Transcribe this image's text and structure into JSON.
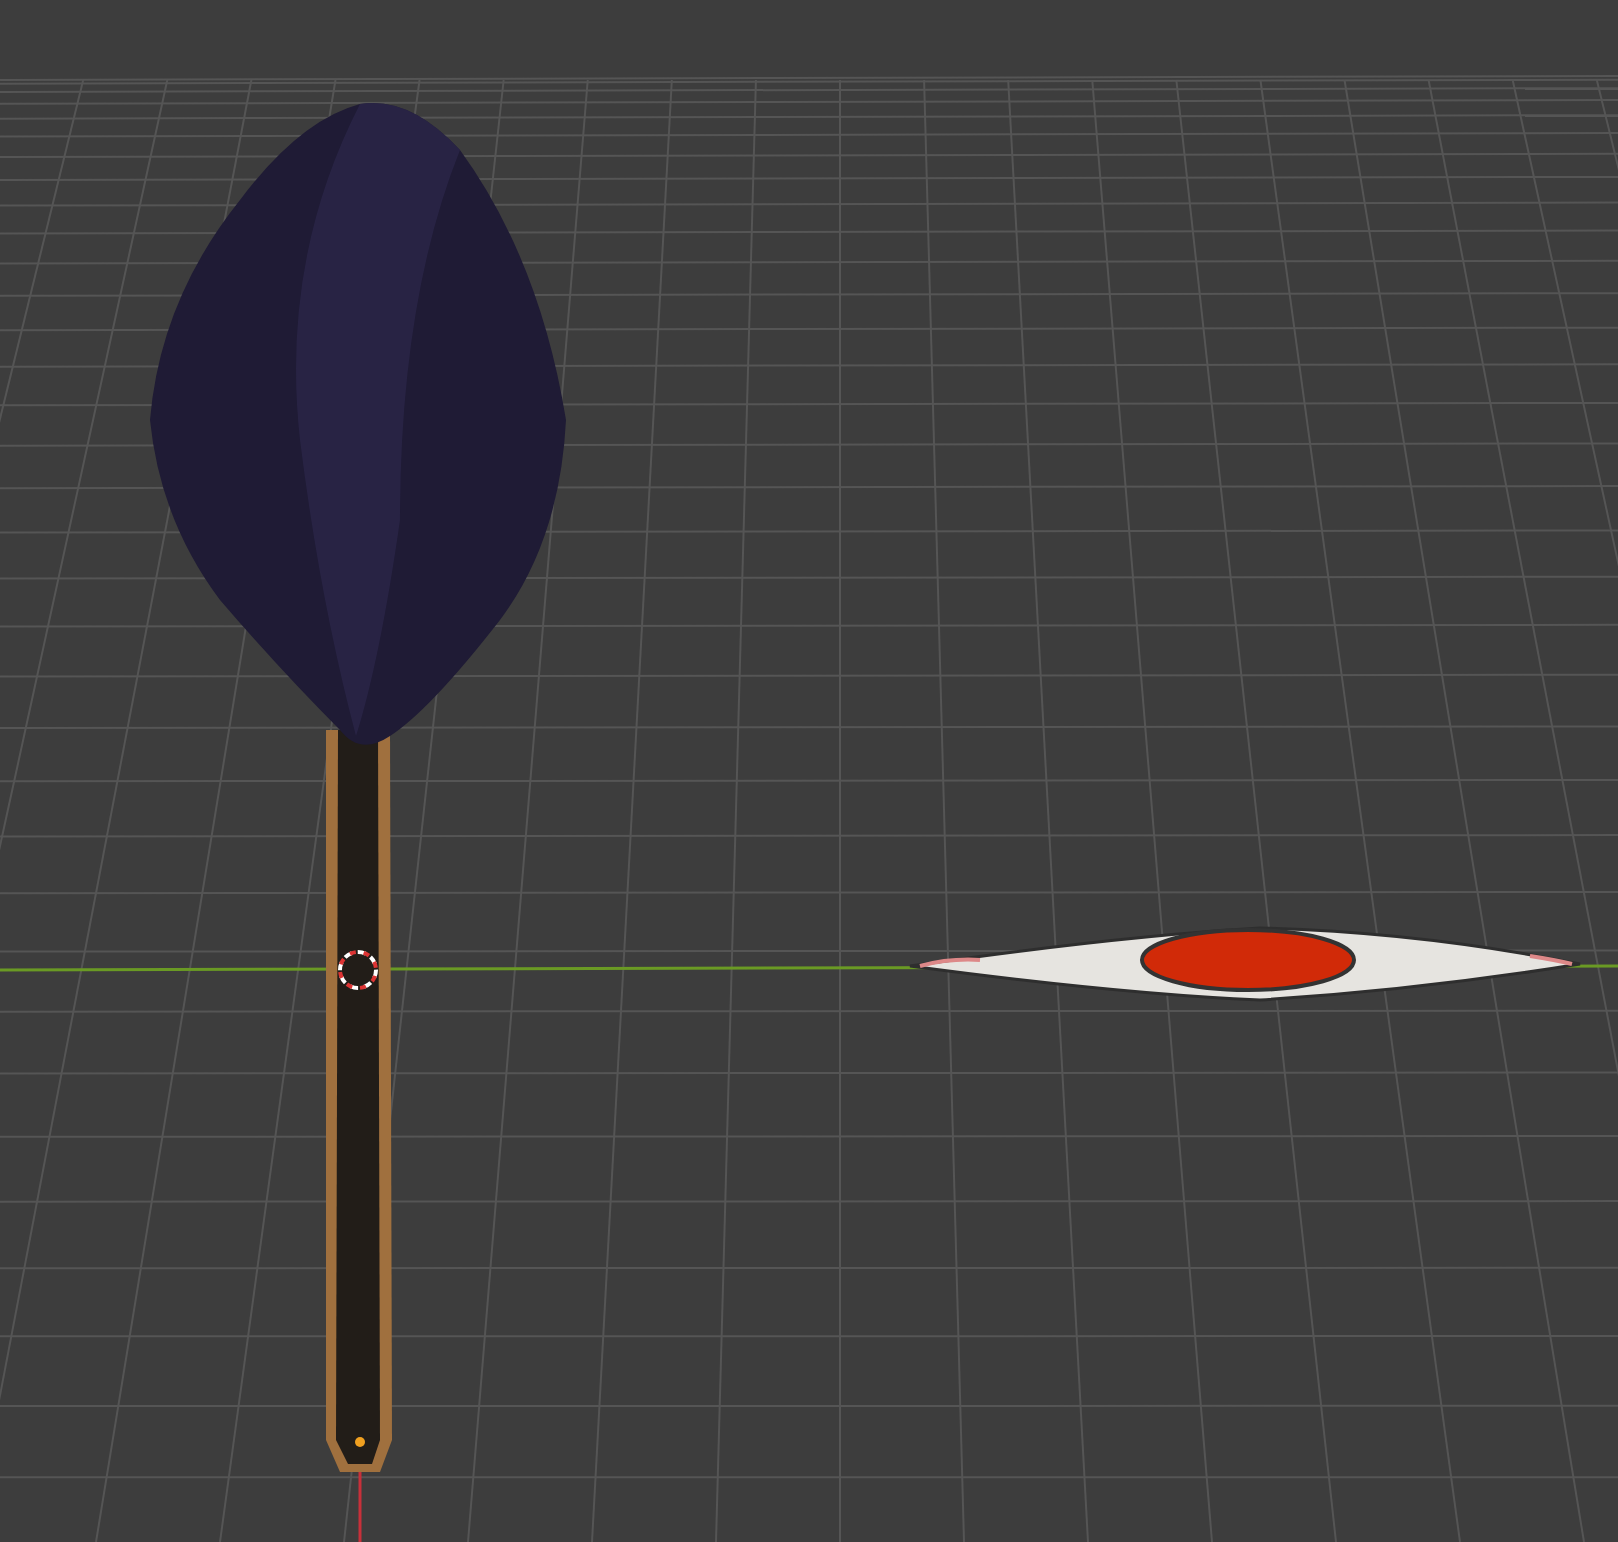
{
  "viewport": {
    "cursor": true
  }
}
